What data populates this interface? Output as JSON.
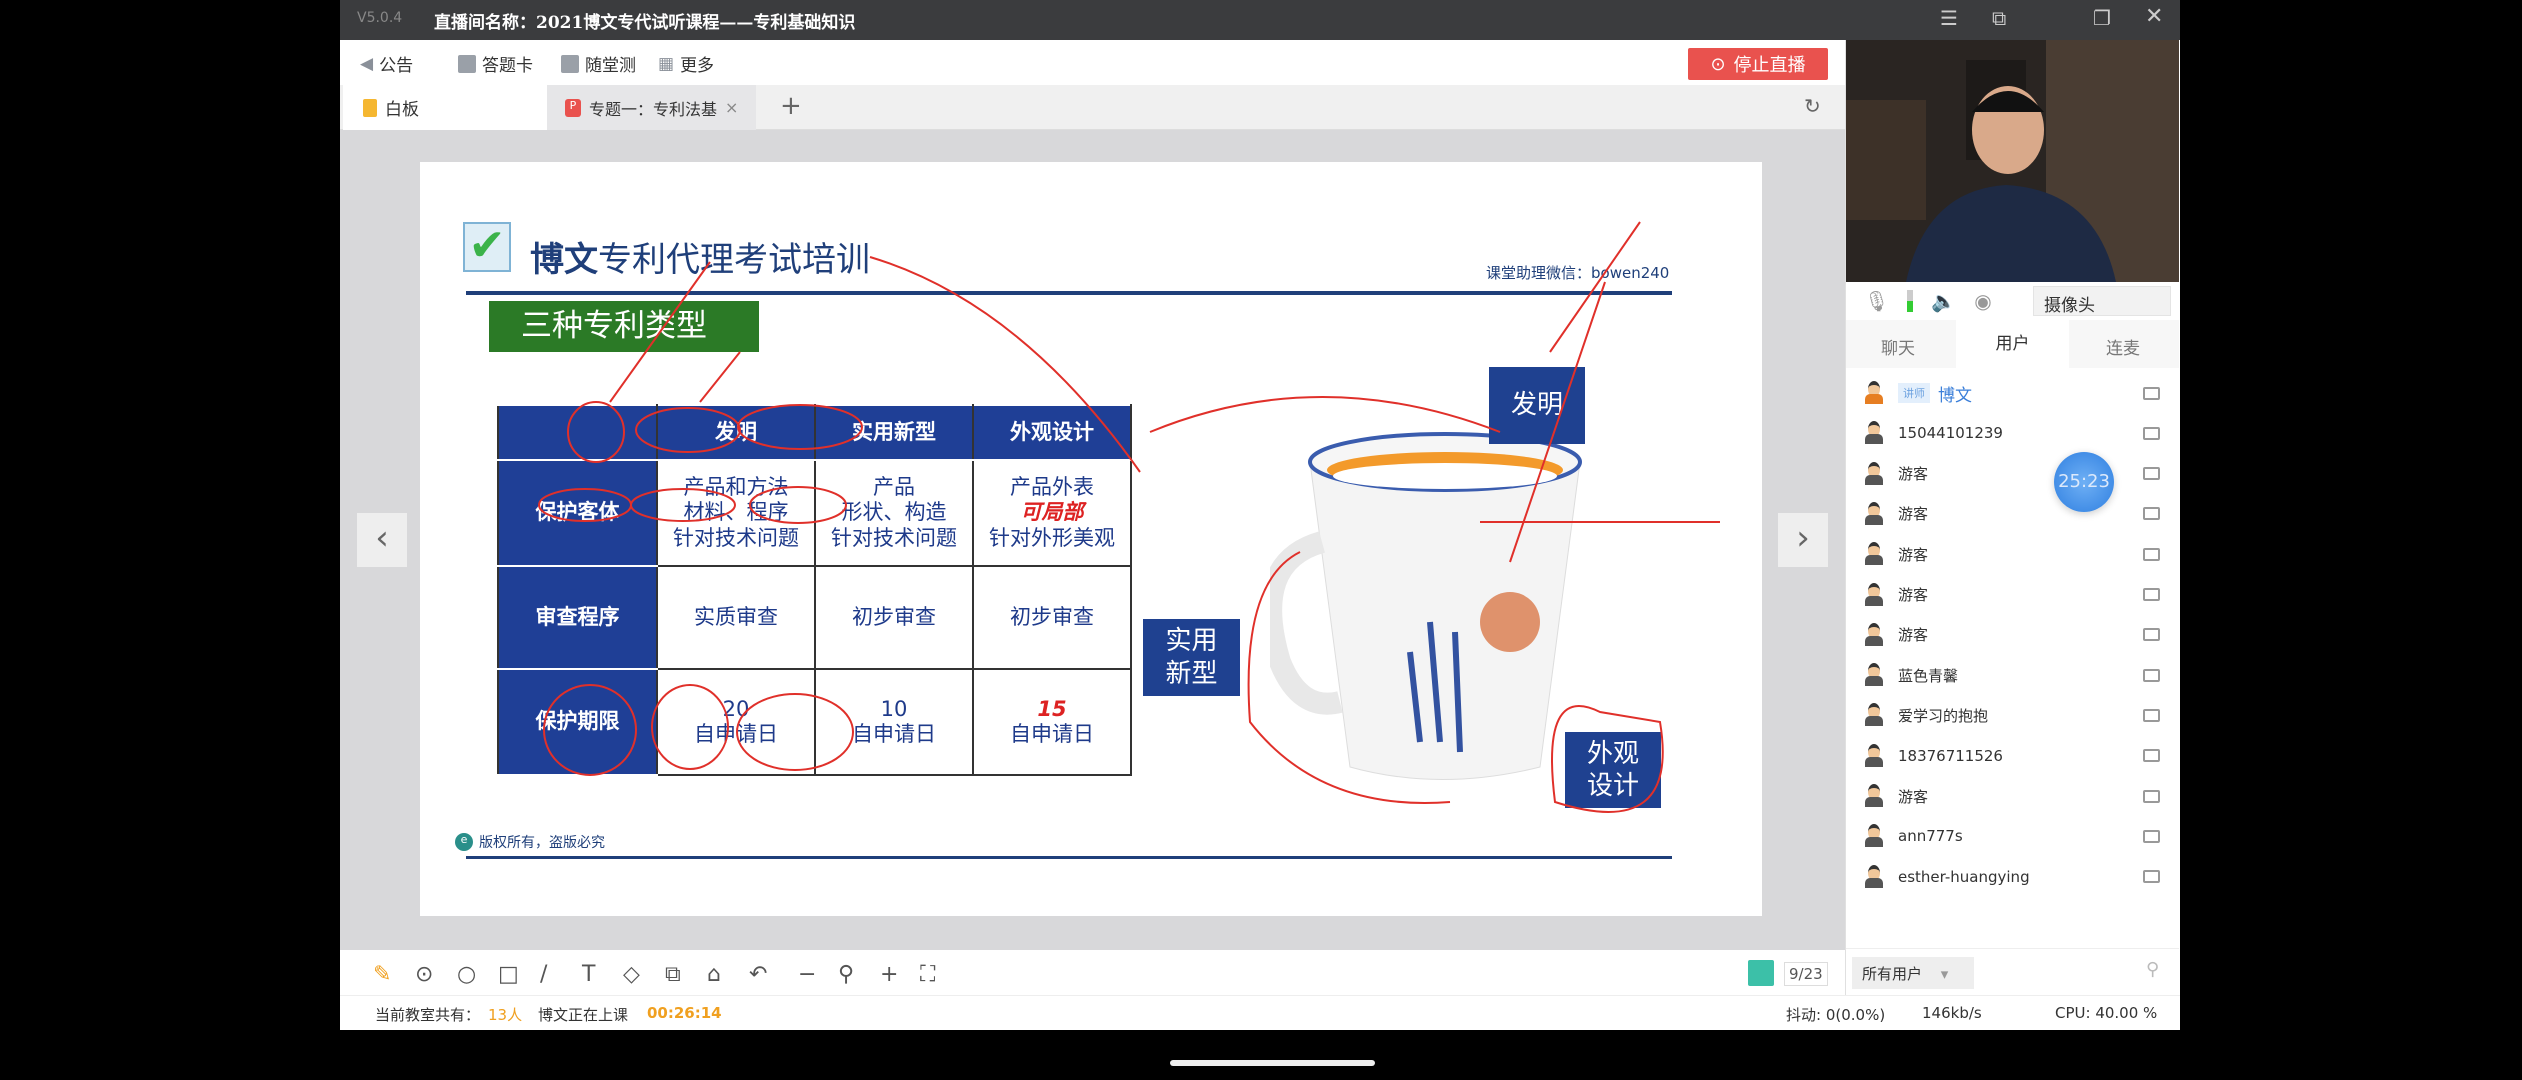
{
  "titlebar": {
    "version": "V5.0.4",
    "title": "直播间名称：2021博文专代试听课程——专利基础知识"
  },
  "toolbar": {
    "items": [
      "公告",
      "答题卡",
      "随堂测",
      "更多"
    ],
    "stop_label": "停止直播"
  },
  "tabs": [
    {
      "label": "白板"
    },
    {
      "label": "专题一：专利法基"
    }
  ],
  "slide": {
    "brand_bold": "博文",
    "brand_rest": "专利代理考试培训",
    "wechat": "课堂助理微信：bowen240",
    "section_title": "三种专利类型",
    "table": {
      "headers": [
        "",
        "发明",
        "实用新型",
        "外观设计"
      ],
      "rows": [
        {
          "label": "保护客体",
          "cells": [
            [
              "产品和方法",
              "材料、程序",
              "针对技术问题"
            ],
            [
              "产品",
              "形状、构造",
              "针对技术问题"
            ],
            [
              "产品外表",
              "可局部",
              "针对外形美观"
            ]
          ]
        },
        {
          "label": "审查程序",
          "cells": [
            [
              "实质审查"
            ],
            [
              "初步审查"
            ],
            [
              "初步审查"
            ]
          ]
        },
        {
          "label": "保护期限",
          "cells": [
            [
              "20",
              "自申请日"
            ],
            [
              "10",
              "自申请日"
            ],
            [
              "15",
              "自申请日"
            ]
          ]
        }
      ]
    },
    "callouts": {
      "invention": "发明",
      "utility": "实用\n新型",
      "design": "外观\n设计"
    },
    "footer": "版权所有，盗版必究"
  },
  "pager": "9/23",
  "status": {
    "prefix": "当前教室共有：",
    "count": "13人",
    "teaching": "博文正在上课",
    "elapsed": "00:26:14",
    "jitter": "抖动: 0(0.0%)",
    "bandwidth": "146kb/s",
    "cpu": "CPU: 40.00 %"
  },
  "right": {
    "camera_select": "摄像头",
    "tabs": [
      "聊天",
      "用户",
      "连麦"
    ],
    "teacher_badge": "讲师",
    "users": [
      "博文",
      "15044101239",
      "游客",
      "游客",
      "游客",
      "游客",
      "游客",
      "蓝色青馨",
      "爱学习的抱抱",
      "18376711526",
      "游客",
      "ann777s",
      "esther-huangying"
    ],
    "timer": "25:23",
    "filter": "所有用户"
  }
}
